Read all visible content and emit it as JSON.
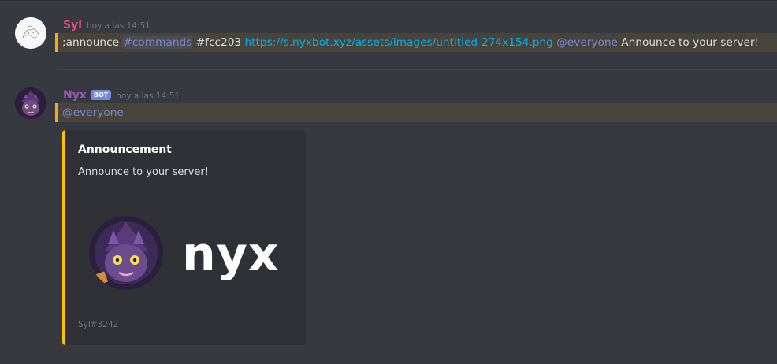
{
  "messages": [
    {
      "username": "Syl",
      "username_color": "#e0506b",
      "timestamp": "hoy a las 14:51",
      "parts": {
        "command": ";announce",
        "channel_mention": "#commands",
        "color_arg": "#fcc203",
        "url": "https://s.nyxbot.xyz/assets/images/untitled-274x154.png",
        "everyone": "@everyone",
        "text": "Announce to your server!"
      },
      "avatar_icon": "sketch-avatar-icon"
    },
    {
      "username": "Nyx",
      "username_color": "#9b59b6",
      "bot_tag": "BOT",
      "timestamp": "hoy a las 14:51",
      "everyone": "@everyone",
      "avatar_icon": "nyx-cat-avatar-icon",
      "embed": {
        "accent_color": "#fcc203",
        "title": "Announcement",
        "description": "Announce to your server!",
        "image_wordmark": "nyx",
        "footer": "Syl#3242"
      }
    }
  ],
  "colors": {
    "background": "#36393f",
    "mention_highlight": "#faa61a",
    "link": "#00b0f4",
    "mention": "#7289da"
  }
}
